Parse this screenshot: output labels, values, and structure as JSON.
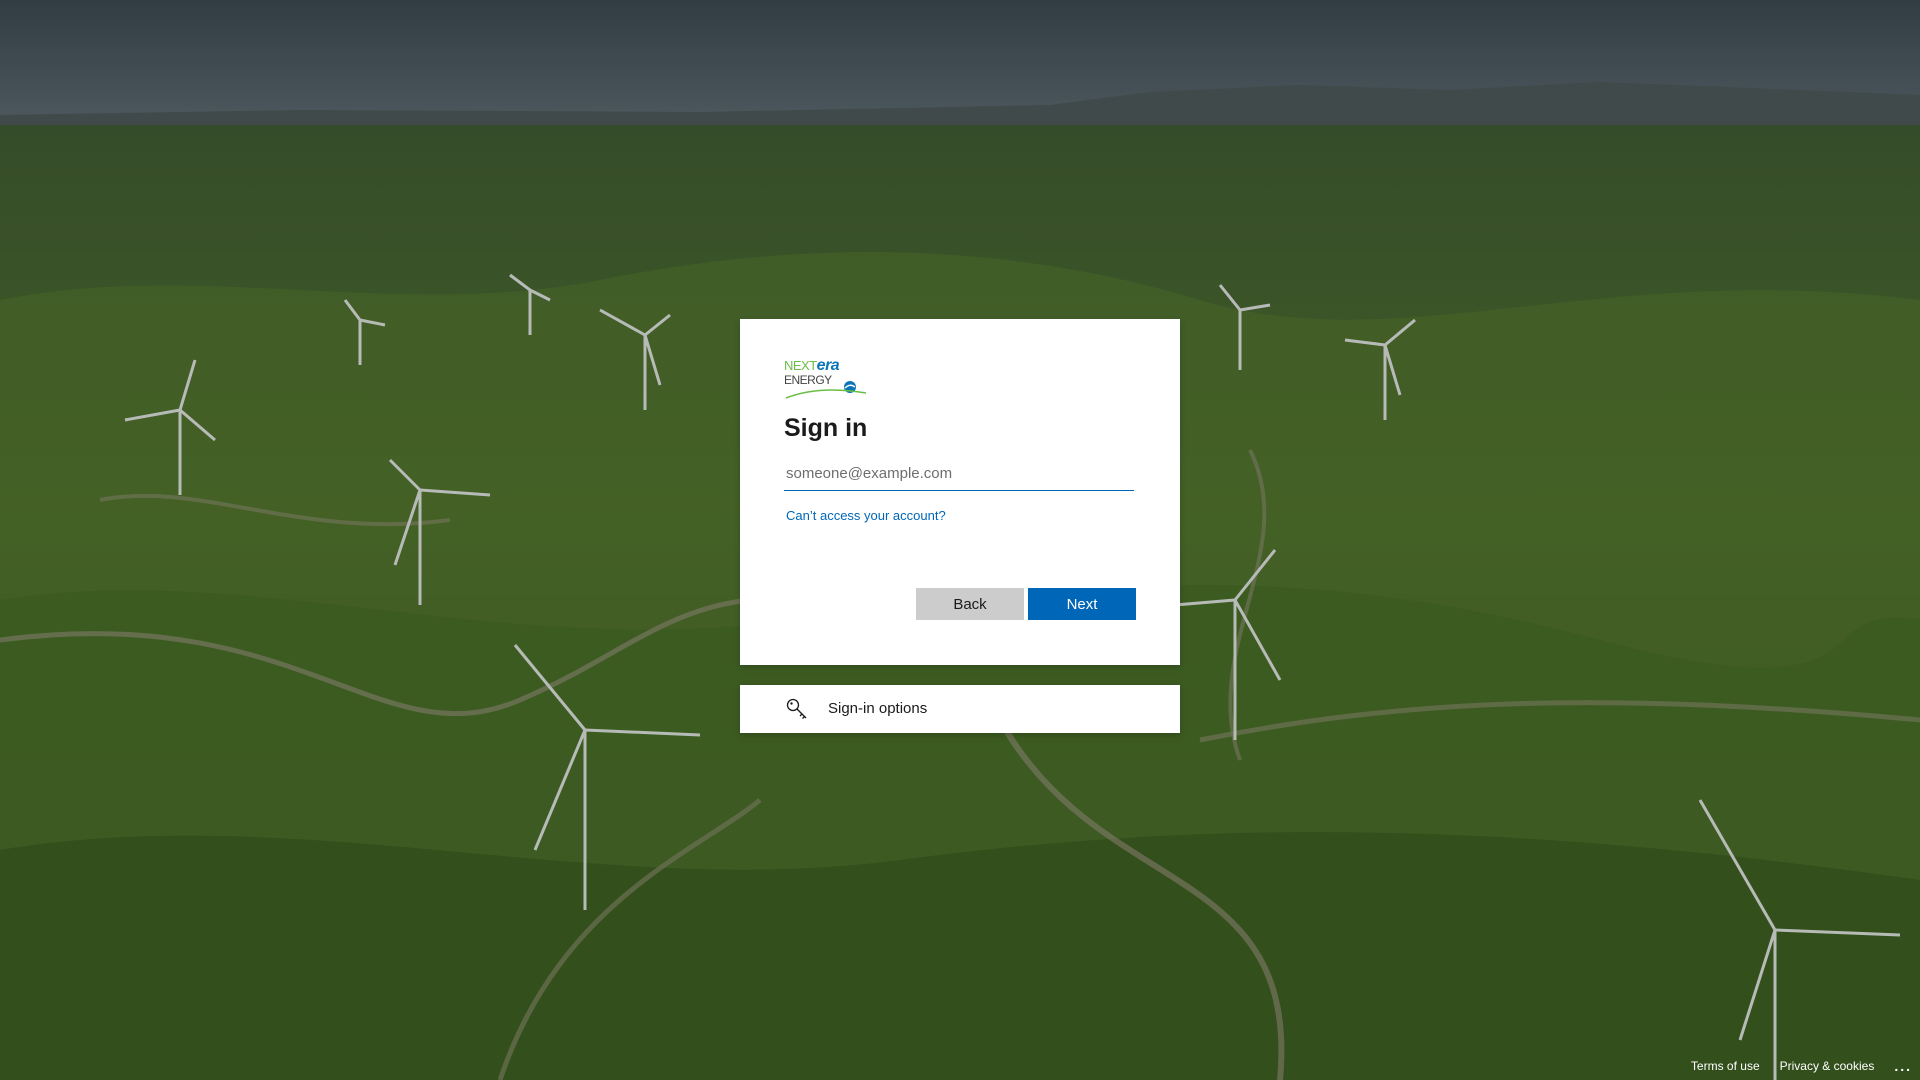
{
  "logo": {
    "next": "NEXT",
    "era": "era",
    "energy": "ENERGY"
  },
  "signin": {
    "title": "Sign in",
    "email_placeholder": "someone@example.com",
    "email_value": "",
    "cant_access_link": "Can’t access your account?",
    "back_label": "Back",
    "next_label": "Next"
  },
  "options": {
    "label": "Sign-in options",
    "icon": "key-icon"
  },
  "footer": {
    "terms": "Terms of use",
    "privacy": "Privacy & cookies",
    "more": "..."
  },
  "colors": {
    "accent": "#0067b8",
    "back_button": "#cccccc",
    "logo_green": "#6bbe45",
    "logo_blue": "#0a74b8"
  }
}
